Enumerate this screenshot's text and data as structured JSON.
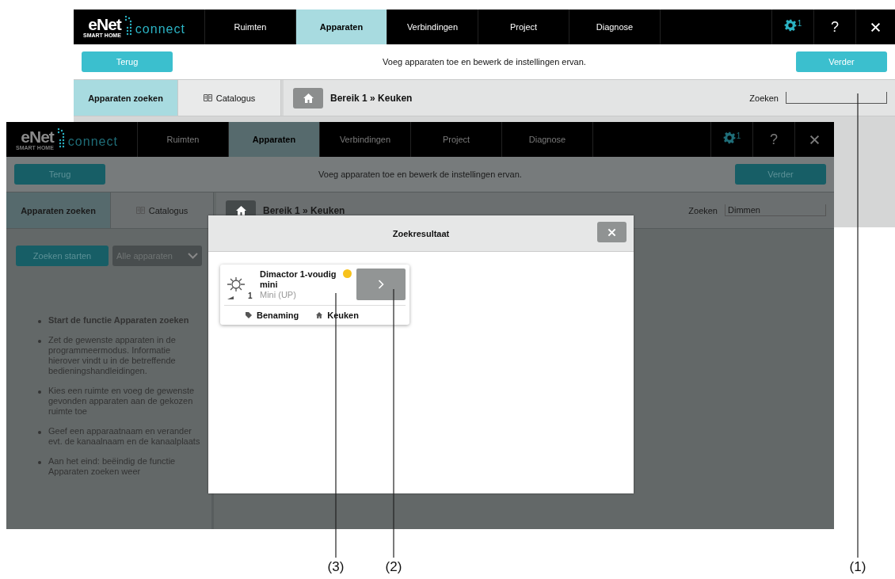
{
  "screens": [
    {
      "dimmed": false,
      "logo": {
        "brand": "eNet",
        "tagline": "SMART HOME",
        "product": "connect"
      },
      "nav": [
        {
          "label": "Ruimten",
          "selected": false
        },
        {
          "label": "Apparaten",
          "selected": true
        },
        {
          "label": "Verbindingen",
          "selected": false
        },
        {
          "label": "Project",
          "selected": false
        },
        {
          "label": "Diagnose",
          "selected": false
        }
      ],
      "settings_badge": "1",
      "help": "?",
      "toolbar": {
        "back": "Terug",
        "instruction": "Voeg apparaten toe en bewerk de instellingen ervan.",
        "next": "Verder"
      },
      "side_tabs": [
        {
          "label": "Apparaten zoeken",
          "selected": true
        },
        {
          "label": "Catalogus",
          "selected": false
        }
      ],
      "breadcrumb": "Bereik 1 » Keuken",
      "search": {
        "label": "Zoeken"
      }
    },
    {
      "dimmed": true,
      "logo": {
        "brand": "eNet",
        "tagline": "SMART HOME",
        "product": "connect"
      },
      "nav": [
        {
          "label": "Ruimten",
          "selected": false
        },
        {
          "label": "Apparaten",
          "selected": true
        },
        {
          "label": "Verbindingen",
          "selected": false
        },
        {
          "label": "Project",
          "selected": false
        },
        {
          "label": "Diagnose",
          "selected": false
        }
      ],
      "settings_badge": "1",
      "help": "?",
      "toolbar": {
        "back": "Terug",
        "instruction": "Voeg apparaten toe en bewerk de instellingen ervan.",
        "next": "Verder"
      },
      "side_tabs": [
        {
          "label": "Apparaten zoeken",
          "selected": true
        },
        {
          "label": "Catalogus",
          "selected": false
        }
      ],
      "breadcrumb": "Bereik 1 » Keuken",
      "search": {
        "label": "Zoeken",
        "value": "Dimmen"
      },
      "sidebar": {
        "search_button": "Zoeken starten",
        "filter": "Alle apparaten",
        "steps": [
          {
            "text": "Start de functie Apparaten zoeken",
            "bold": true
          },
          {
            "text": "Zet de gewenste apparaten in de programmeermodus. Informatie hierover vindt u in de betreffende bedieningshandleidingen.",
            "bold": false
          },
          {
            "text": "Kies een ruimte en voeg de gewenste gevonden apparaten aan de gekozen ruimte toe",
            "bold": false
          },
          {
            "text": "Geef een apparaatnaam en verander evt. de kanaalnaam en de kanaalplaats",
            "bold": false
          },
          {
            "text": "Aan het eind: beëindig de functie Apparaten zoeken weer",
            "bold": false
          }
        ]
      },
      "modal": {
        "title": "Zoekresultaat",
        "results": [
          {
            "name": "Dimactor 1-voudig mini",
            "type": "Mini (UP)",
            "channel": "1",
            "color": "#f7c21c",
            "name_label": "Benaming",
            "room": "Keuken"
          }
        ]
      }
    }
  ],
  "callouts": [
    {
      "label": "(3)"
    },
    {
      "label": "(2)"
    },
    {
      "label": "(1)"
    }
  ]
}
